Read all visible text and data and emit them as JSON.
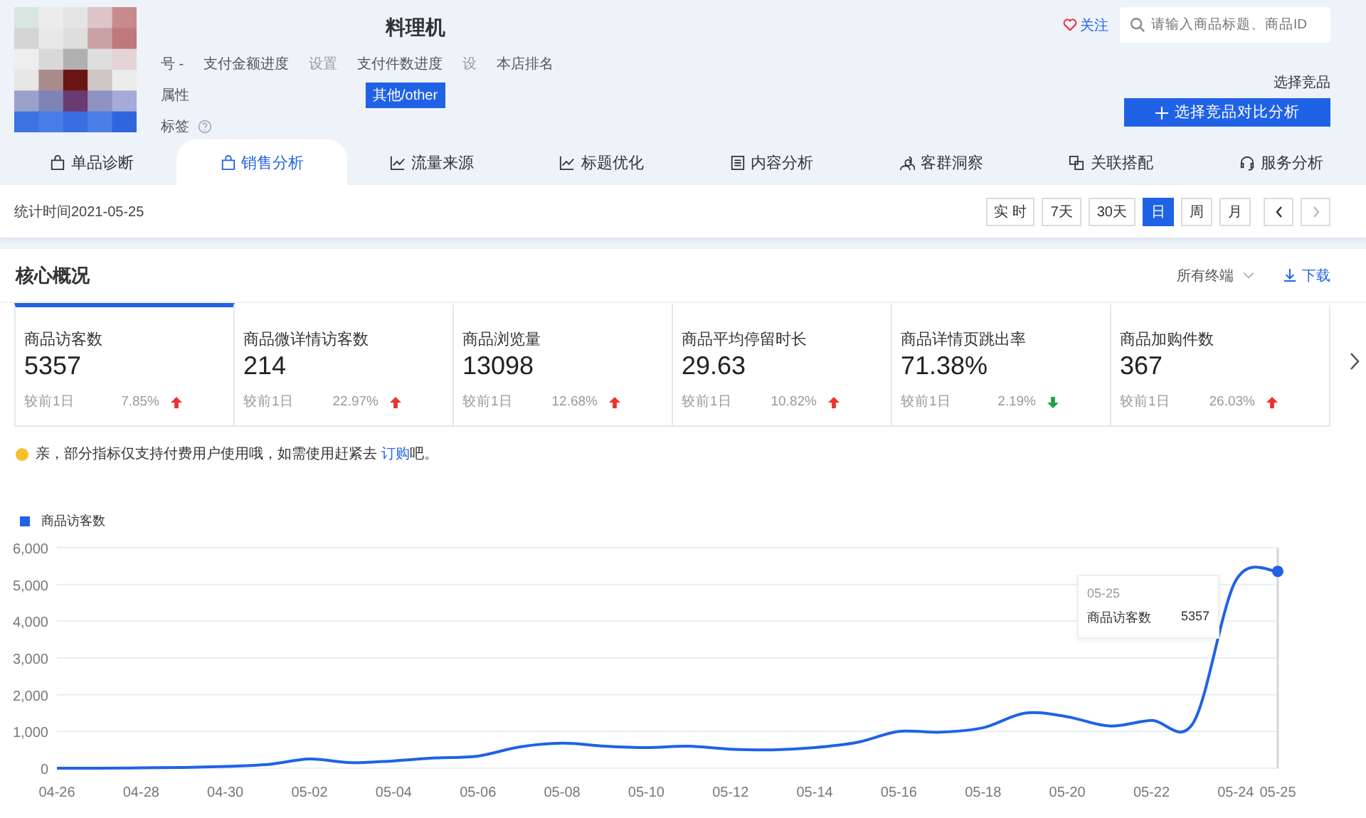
{
  "product": {
    "title": "料理机",
    "rows": [
      {
        "kind": "progress",
        "items": [
          "号 -",
          "支付金额进度",
          "设置",
          "支付件数进度",
          "设",
          "本店排名"
        ]
      },
      {
        "kind": "tags",
        "label": "属性",
        "tags": [
          "其他/other"
        ]
      },
      {
        "kind": "help",
        "label": "标签"
      }
    ]
  },
  "follow": {
    "label": "关注"
  },
  "search": {
    "placeholder": "请输入商品标题、商品ID"
  },
  "compare": {
    "caption": "选择竞品",
    "button": "选择竞品对比分析"
  },
  "tabs": [
    {
      "label": "单品诊断",
      "selected": false
    },
    {
      "label": "销售分析",
      "selected": true
    },
    {
      "label": "流量来源",
      "selected": false
    },
    {
      "label": "标题优化",
      "selected": false
    },
    {
      "label": "内容分析",
      "selected": false
    },
    {
      "label": "客群洞察",
      "selected": false
    },
    {
      "label": "关联搭配",
      "selected": false
    },
    {
      "label": "服务分析",
      "selected": false
    }
  ],
  "stat_time": "统计时间2021-05-25",
  "periods": [
    {
      "label": "实 时",
      "selected": false
    },
    {
      "label": "7天",
      "selected": false
    },
    {
      "label": "30天",
      "selected": false
    },
    {
      "label": "日",
      "selected": true
    },
    {
      "label": "周",
      "selected": false
    },
    {
      "label": "月",
      "selected": false
    }
  ],
  "overview": {
    "title": "核心概况",
    "terminal": "所有终端",
    "download": "下载",
    "metrics": [
      {
        "name": "商品访客数",
        "value": "5357",
        "compare": "较前1日",
        "change": "7.85%",
        "rising": true,
        "selected": true
      },
      {
        "name": "商品微详情访客数",
        "value": "214",
        "compare": "较前1日",
        "change": "22.97%",
        "rising": true,
        "selected": false
      },
      {
        "name": "商品浏览量",
        "value": "13098",
        "compare": "较前1日",
        "change": "12.68%",
        "rising": true,
        "selected": false
      },
      {
        "name": "商品平均停留时长",
        "value": "29.63",
        "compare": "较前1日",
        "change": "10.82%",
        "rising": true,
        "selected": false
      },
      {
        "name": "商品详情页跳出率",
        "value": "71.38%",
        "compare": "较前1日",
        "change": "2.19%",
        "rising": false,
        "selected": false
      },
      {
        "name": "商品加购件数",
        "value": "367",
        "compare": "较前1日",
        "change": "26.03%",
        "rising": true,
        "selected": false
      }
    ],
    "notice": {
      "text": "亲，部分指标仅支持付费用户使用哦，如需使用赶紧去 ",
      "link": "订购",
      "tail": "吧。"
    },
    "tooltip": {
      "date": "05-25",
      "name": "商品访客数",
      "value": "5357"
    },
    "chart_data": {
      "type": "line",
      "grid": true,
      "categories": [
        "04-26",
        null,
        "04-28",
        null,
        "04-30",
        null,
        "05-02",
        null,
        "05-04",
        null,
        "05-06",
        null,
        "05-08",
        null,
        "05-10",
        null,
        "05-12",
        null,
        "05-14",
        null,
        "05-16",
        null,
        "05-18",
        null,
        "05-20",
        null,
        "05-22",
        null,
        "05-24",
        "05-25"
      ],
      "series": [
        {
          "name": "商品访客数",
          "color": "#2062e6",
          "values": [
            0,
            0,
            10,
            20,
            50,
            100,
            250,
            150,
            200,
            280,
            330,
            580,
            680,
            600,
            560,
            600,
            520,
            500,
            560,
            700,
            1000,
            980,
            1100,
            1500,
            1400,
            1150,
            1300,
            1250,
            5100,
            5357
          ]
        }
      ],
      "ylim": [
        0,
        6000
      ],
      "yticks": [
        {
          "value": 0,
          "label": "0"
        },
        {
          "value": 1000,
          "label": "1,000"
        },
        {
          "value": 2000,
          "label": "2,000"
        },
        {
          "value": 3000,
          "label": "3,000"
        },
        {
          "value": 4000,
          "label": "4,000"
        },
        {
          "value": 5000,
          "label": "5,000"
        },
        {
          "value": 6000,
          "label": "6,000"
        }
      ]
    }
  }
}
